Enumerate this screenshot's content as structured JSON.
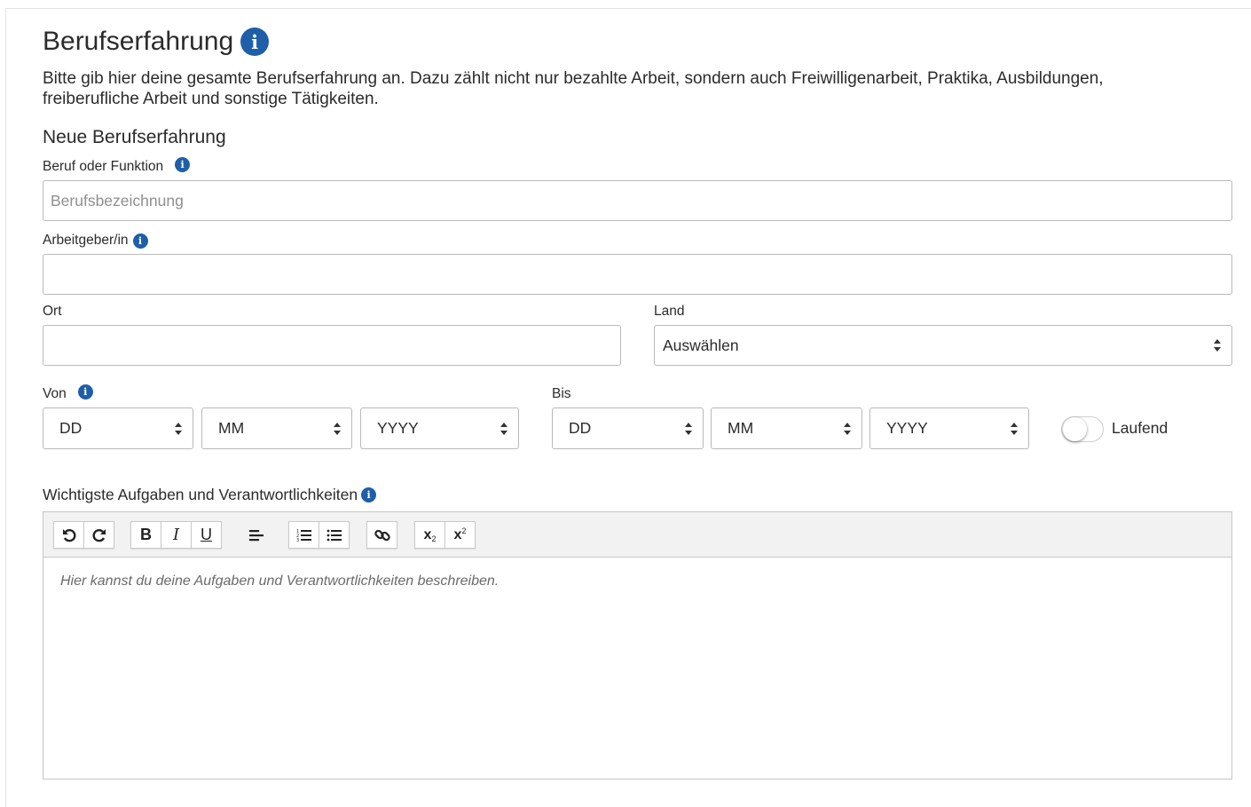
{
  "header": {
    "title": "Berufserfahrung",
    "description": "Bitte gib hier deine gesamte Berufserfahrung an. Dazu zählt nicht nur bezahlte Arbeit, sondern auch Freiwilligenarbeit, Praktika, Ausbildungen, freiberufliche Arbeit und sonstige Tätigkeiten."
  },
  "form": {
    "subtitle": "Neue Berufserfahrung",
    "job": {
      "label": "Beruf oder Funktion",
      "placeholder": "Berufsbezeichnung",
      "value": ""
    },
    "employer": {
      "label": "Arbeitgeber/in",
      "value": ""
    },
    "city": {
      "label": "Ort",
      "value": ""
    },
    "country": {
      "label": "Land",
      "selected": "Auswählen"
    },
    "from": {
      "label": "Von",
      "day": "DD",
      "month": "MM",
      "year": "YYYY"
    },
    "to": {
      "label": "Bis",
      "day": "DD",
      "month": "MM",
      "year": "YYYY"
    },
    "ongoing": {
      "label": "Laufend",
      "checked": false
    },
    "tasks": {
      "label": "Wichtigste Aufgaben und Verantwortlichkeiten",
      "placeholder": "Hier kannst du deine Aufgaben und Verantwortlichkeiten beschreiben."
    }
  },
  "toolbar": {
    "bold": "B",
    "italic": "I",
    "underline": "U",
    "subscript": "x",
    "subscript_index": "2",
    "superscript": "x",
    "superscript_index": "2"
  },
  "icons": [
    "info-icon",
    "undo-icon",
    "redo-icon",
    "align-left-icon",
    "ordered-list-icon",
    "bullet-list-icon",
    "link-icon",
    "caret-updown-icon"
  ],
  "colors": {
    "accent": "#1f5fa8",
    "border": "#b9b9b9",
    "toolbar_bg": "#f2f2f2"
  }
}
